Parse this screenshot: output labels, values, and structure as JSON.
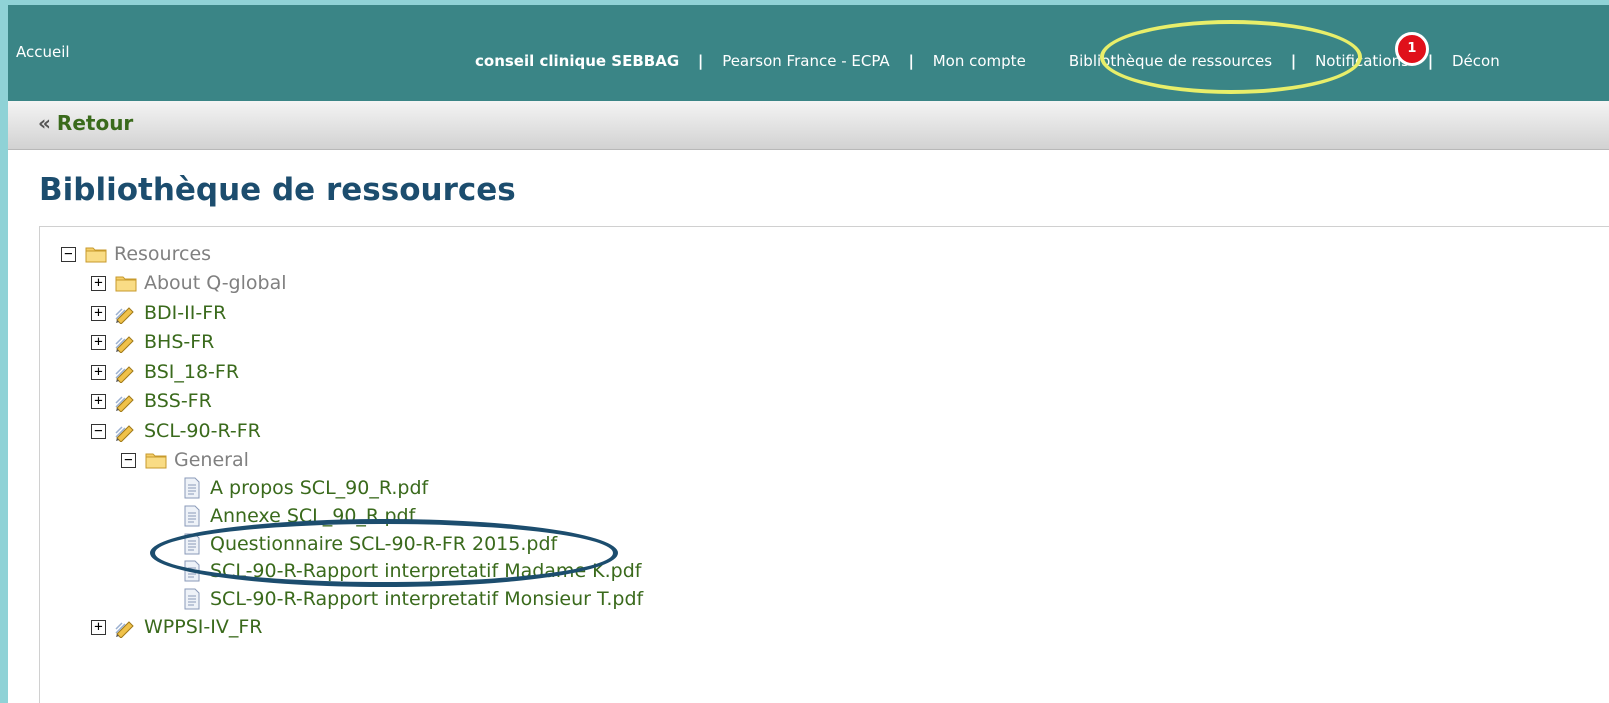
{
  "header": {
    "home": "Accueil",
    "user": "conseil clinique SEBBAG",
    "separator": "|",
    "links": {
      "org": "Pearson France - ECPA",
      "account": "Mon compte",
      "library": "Bibliothèque de ressources",
      "notifications": "Notifications",
      "logout": "Décon"
    },
    "notification_count": "1",
    "highlight_color": "#e8ee6a"
  },
  "backbar": {
    "chevron": "«",
    "label": "Retour"
  },
  "page": {
    "title": "Bibliothèque de ressources"
  },
  "tree": {
    "root": "Resources",
    "about": "About Q-global",
    "items": [
      "BDI-II-FR",
      "BHS-FR",
      "BSI_18-FR",
      "BSS-FR",
      "SCL-90-R-FR",
      "WPPSI-IV_FR"
    ],
    "general": "General",
    "files": [
      "A propos SCL_90_R.pdf",
      "Annexe SCL_90_R.pdf",
      "Questionnaire SCL-90-R-FR 2015.pdf",
      "SCL-90-R-Rapport interpretatif Madame K.pdf",
      "SCL-90-R-Rapport interpretatif Monsieur T.pdf"
    ],
    "toggle_expanded": "−",
    "toggle_collapsed": "+",
    "icons": {
      "folder": "folder-icon",
      "assessment": "pencil-icon",
      "file": "document-icon"
    },
    "highlight_color": "#1c4d6e"
  },
  "colors": {
    "header_bg": "#3a8586",
    "title": "#1c4d6e",
    "link_green": "#3a6a1c",
    "badge": "#e0101a"
  }
}
